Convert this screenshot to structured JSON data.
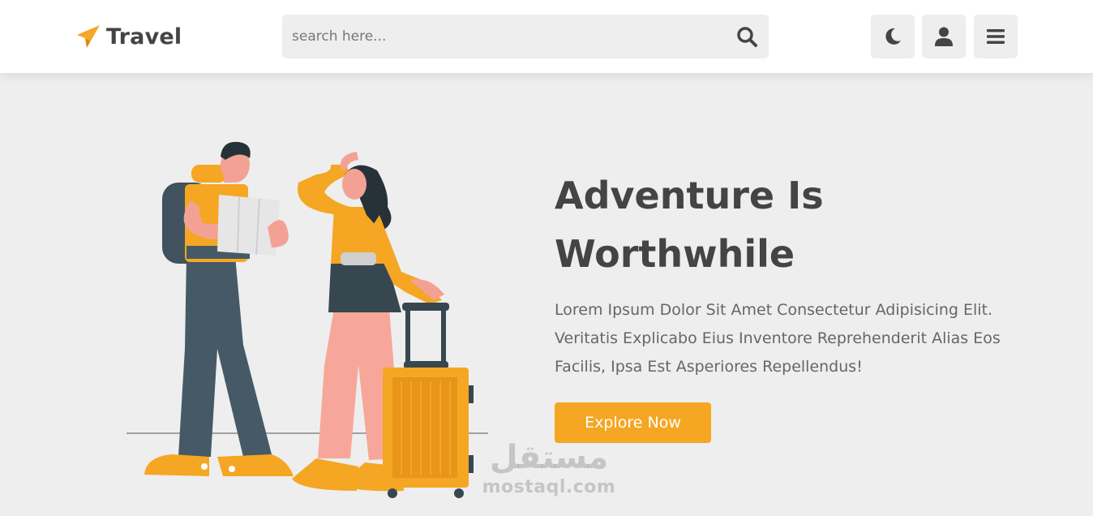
{
  "header": {
    "logo": {
      "text": "Travel",
      "icon": "paper-plane-icon",
      "color": "#f5a623"
    },
    "search": {
      "placeholder": "search here...",
      "value": "",
      "icon": "search-icon"
    },
    "buttons": [
      {
        "icon": "moon-icon"
      },
      {
        "icon": "user-icon"
      },
      {
        "icon": "menu-icon"
      }
    ]
  },
  "hero": {
    "title_line1": "Adventure Is",
    "title_line2": "Worthwhile",
    "description": "Lorem Ipsum Dolor Sit Amet Consectetur Adipisicing Elit. Veritatis Explicabo Eius Inventore Reprehenderit Alias Eos Facilis, Ipsa Est Asperiores Repellendus!",
    "cta_label": "Explore Now",
    "illustration": "travelers-couple-illustration"
  },
  "watermark": {
    "arabic": "مستقل",
    "latin": "mostaql.com"
  },
  "colors": {
    "accent": "#f5a623",
    "text": "#444444",
    "background": "#eeeeee",
    "header_bg": "#ffffff"
  }
}
